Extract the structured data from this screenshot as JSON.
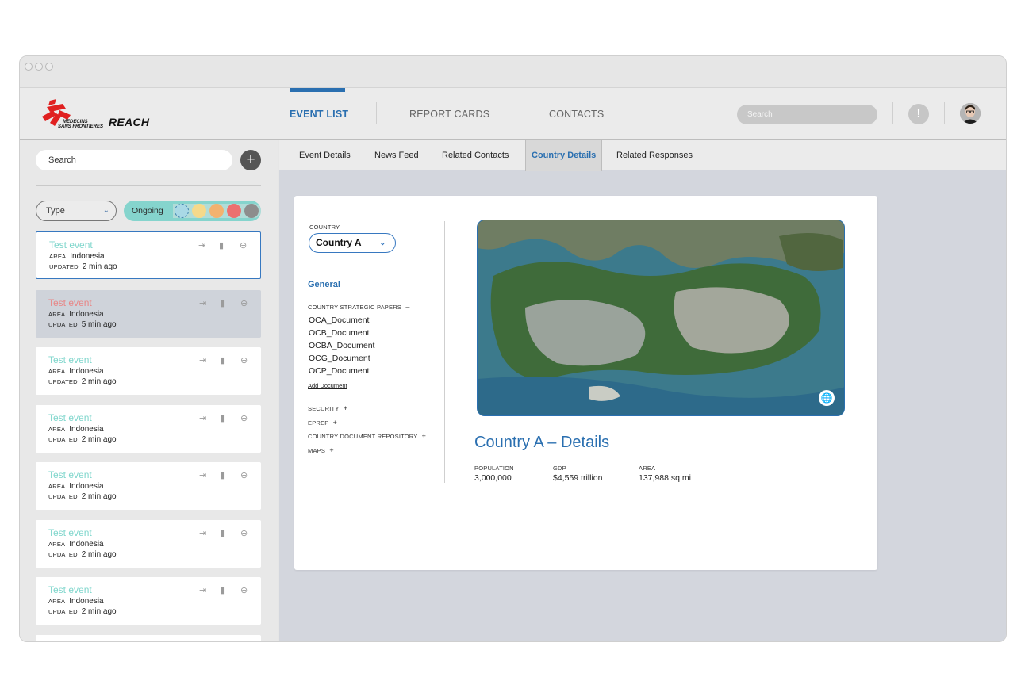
{
  "header": {
    "brand": "REACH",
    "brand_org_line1": "MEDECINS",
    "brand_org_line2": "SANS FRONTIERES",
    "nav": [
      {
        "label": "EVENT LIST"
      },
      {
        "label": "REPORT CARDS"
      },
      {
        "label": "CONTACTS"
      }
    ],
    "search_placeholder": "Search",
    "alert_glyph": "!"
  },
  "sidebar": {
    "search_placeholder": "Search",
    "add_glyph": "+",
    "type_filter": "Type",
    "status_filter": "Ongoing",
    "status_colors": [
      "#a9d9e6",
      "#f5d98a",
      "#f2b26f",
      "#ec7070",
      "#8d8d8d"
    ],
    "cards": [
      {
        "title": "Test event",
        "area_label": "AREA",
        "area": "Indonesia",
        "updated_label": "UPDATED",
        "updated": "2 min ago"
      },
      {
        "title": "Test event",
        "area_label": "AREA",
        "area": "Indonesia",
        "updated_label": "UPDATED",
        "updated": "5 min ago"
      },
      {
        "title": "Test event",
        "area_label": "AREA",
        "area": "Indonesia",
        "updated_label": "UPDATED",
        "updated": "2 min ago"
      },
      {
        "title": "Test event",
        "area_label": "AREA",
        "area": "Indonesia",
        "updated_label": "UPDATED",
        "updated": "2 min ago"
      },
      {
        "title": "Test event",
        "area_label": "AREA",
        "area": "Indonesia",
        "updated_label": "UPDATED",
        "updated": "2 min ago"
      },
      {
        "title": "Test event",
        "area_label": "AREA",
        "area": "Indonesia",
        "updated_label": "UPDATED",
        "updated": "2 min ago"
      },
      {
        "title": "Test event",
        "area_label": "AREA",
        "area": "Indonesia",
        "updated_label": "UPDATED",
        "updated": "2 min ago"
      }
    ]
  },
  "tabs": [
    {
      "label": "Event Details"
    },
    {
      "label": "News Feed"
    },
    {
      "label": "Related Contacts"
    },
    {
      "label": "Country Details"
    },
    {
      "label": "Related Responses"
    }
  ],
  "country_panel": {
    "country_caption": "COUNTRY",
    "country_value": "Country A",
    "general_label": "General",
    "strategic_papers_label": "COUNTRY STRATEGIC PAPERS",
    "strategic_papers_toggle": "–",
    "documents": [
      "OCA_Document",
      "OCB_Document",
      "OCBA_Document",
      "OCG_Document",
      "OCP_Document"
    ],
    "add_document": "Add Document",
    "sections": [
      {
        "label": "SECURITY",
        "toggle": "+"
      },
      {
        "label": "EPREP",
        "toggle": "+"
      },
      {
        "label": "COUNTRY DOCUMENT REPOSITORY",
        "toggle": "+"
      },
      {
        "label": "MAPS",
        "toggle": "+"
      }
    ],
    "details_title": "Country A – Details",
    "stats": [
      {
        "label": "POPULATION",
        "value": "3,000,000"
      },
      {
        "label": "GDP",
        "value": "$4,559 trillion"
      },
      {
        "label": "AREA",
        "value": "137,988 sq mi"
      }
    ]
  },
  "colors": {
    "accent": "#2a6fb0",
    "event_title": "#7fd6cc",
    "event_title_alert": "#e88787",
    "status_pill": "#85d4cd"
  }
}
